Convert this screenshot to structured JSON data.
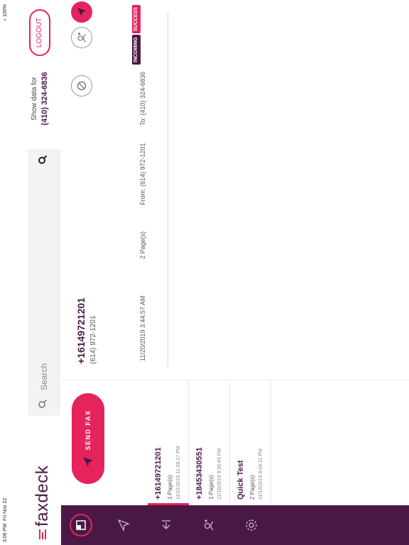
{
  "status_bar": {
    "time": "3:06 PM",
    "date": "Fri Nov 22",
    "battery": "100%"
  },
  "header": {
    "logo_text": "faxdeck",
    "search_placeholder": "Search",
    "show_data_label": "Show data for",
    "show_data_number": "(410) 324-6836",
    "logout_label": "LOGOUT"
  },
  "sidebar": {
    "items": [
      {
        "icon": "inbox-icon",
        "active": true
      },
      {
        "icon": "send-icon",
        "active": false
      },
      {
        "icon": "logout-arrow-icon",
        "active": false
      },
      {
        "icon": "contacts-icon",
        "active": false
      },
      {
        "icon": "gear-icon",
        "active": false
      }
    ]
  },
  "left_panel": {
    "send_fax_label": "SEND FAX",
    "faxes": [
      {
        "number": "+16149721201",
        "pages": "1 Page(s)",
        "date": "11/21/2019 11:08:17 PM",
        "selected": true
      },
      {
        "number": "+18453430551",
        "pages": "1 Page(s)",
        "date": "11/19/2019 9:35:43 PM",
        "selected": false
      },
      {
        "number": "Quick Test",
        "pages": "2 Page(s)",
        "date": "11/19/2019 8:04:11 PM",
        "selected": false
      }
    ]
  },
  "detail": {
    "number": "+16149721201",
    "number_formatted": "(614) 972-1201",
    "row": {
      "date": "11/20/2019 3:44:57 AM",
      "pages": "2 Page(s)",
      "from": "From: (614) 972-1201",
      "to": "To: (410) 324-6836",
      "badge_incoming": "INCOMING",
      "badge_success": "SUCCESS"
    }
  },
  "colors": {
    "brand_purple": "#4a1845",
    "brand_pink": "#e5245e"
  }
}
